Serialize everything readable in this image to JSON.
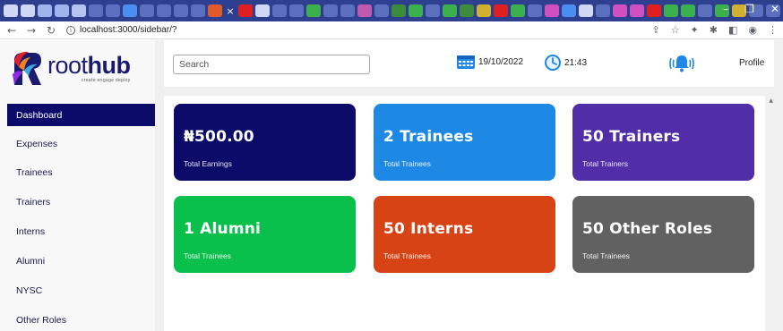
{
  "browser": {
    "url": "localhost:3000/sidebar/?",
    "tab_favicon_colors": [
      "#cfd8f5",
      "#cfd8f5",
      "#9fb3ec",
      "#9fb3ec",
      "#b5c4f0",
      "#5b6fbf",
      "#5b6fbf",
      "#4a8ef0",
      "#5b6fbf",
      "#5b6fbf",
      "#5b6fbf",
      "#5b6fbf",
      "#e05a2a",
      "#e02020",
      "#cfd8f5",
      "#5b6fbf",
      "#5b6fbf",
      "#3cb04c",
      "#5b6fbf",
      "#5b6fbf",
      "#c05ab0",
      "#5b6fbf",
      "#3c8c3c",
      "#3cb04c",
      "#5b6fbf",
      "#3cb04c",
      "#3c8c3c",
      "#d0b030",
      "#e02020",
      "#3cb04c",
      "#5b6fbf",
      "#d050c0",
      "#4a8ef0",
      "#cfd8f5",
      "#5b6fbf",
      "#d050c0",
      "#d050c0",
      "#e02020",
      "#3cb04c",
      "#3cb04c",
      "#5b6fbf",
      "#3cb04c",
      "#d0b030",
      "#5b6fbf",
      "#5b6fbf"
    ]
  },
  "logo": {
    "word_light": "root",
    "word_bold": "hub",
    "tagline": "create engage deploy"
  },
  "sidebar": {
    "items": [
      {
        "label": "Dashboard",
        "active": true
      },
      {
        "label": "Expenses",
        "active": false
      },
      {
        "label": "Trainees",
        "active": false
      },
      {
        "label": "Trainers",
        "active": false
      },
      {
        "label": "Interns",
        "active": false
      },
      {
        "label": "Alumni",
        "active": false
      },
      {
        "label": "NYSC",
        "active": false
      },
      {
        "label": "Other Roles",
        "active": false
      }
    ]
  },
  "topbar": {
    "search_placeholder": "Search",
    "date": "19/10/2022",
    "time": "21:43",
    "profile_label": "Profile"
  },
  "cards": [
    {
      "value": "₦500.00",
      "label": "Total Earnings",
      "color": "#0c0b6a"
    },
    {
      "value": "2 Trainees",
      "label": "Total Trainees",
      "color": "#1e88e5"
    },
    {
      "value": "50 Trainers",
      "label": "Total Trainers",
      "color": "#512da8"
    },
    {
      "value": "1 Alumni",
      "label": "Total Trainees",
      "color": "#0ac04c"
    },
    {
      "value": "50 Interns",
      "label": "Total Trainees",
      "color": "#d84315"
    },
    {
      "value": "50 Other Roles",
      "label": "Total Trainees",
      "color": "#616161"
    }
  ]
}
